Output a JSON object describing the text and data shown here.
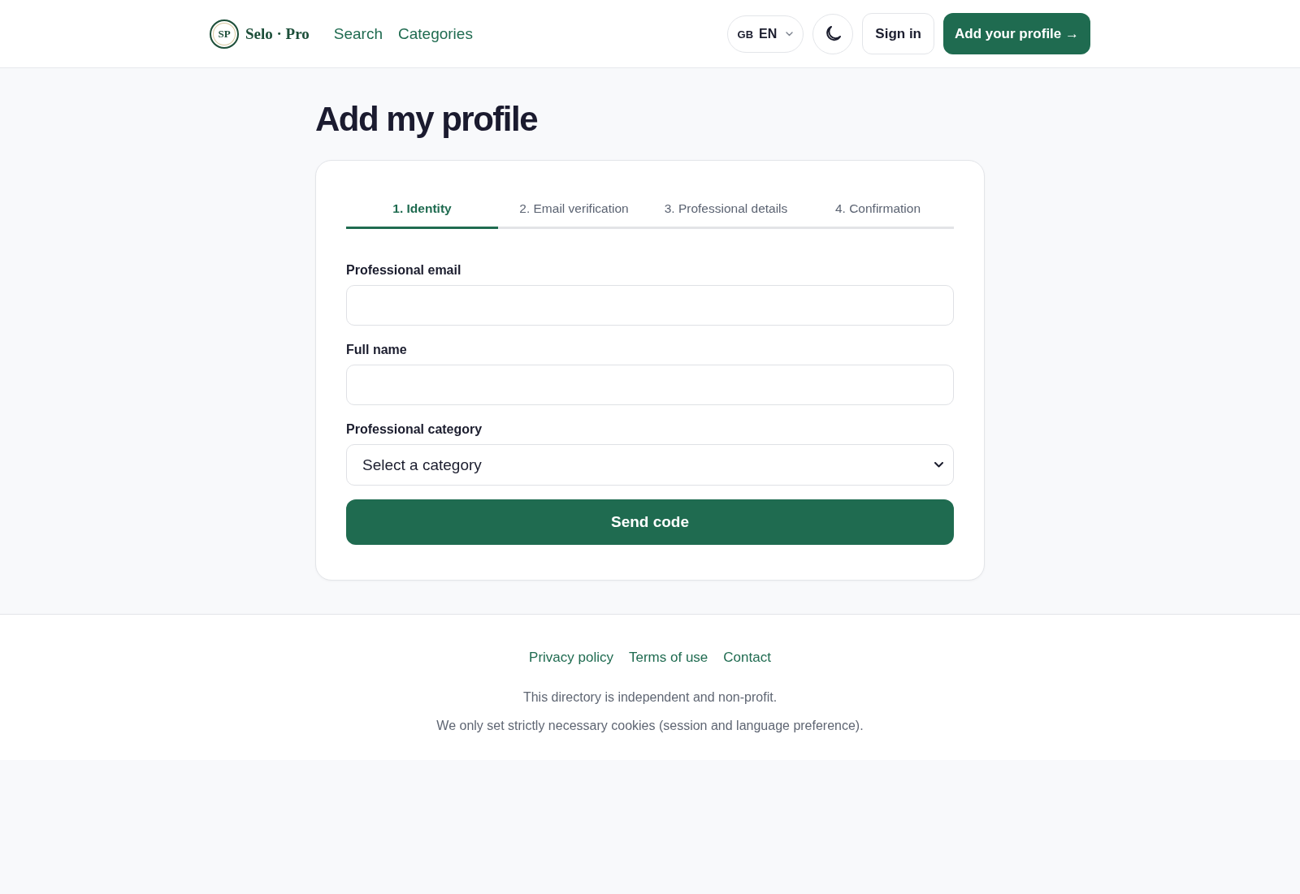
{
  "header": {
    "logo": {
      "monogram": "SP",
      "wordmark": "Selo · Pro"
    },
    "nav": [
      "Search",
      "Categories"
    ],
    "language": {
      "flag": "GB",
      "code": "EN"
    },
    "sign_in": "Sign in",
    "add_profile": "Add your profile →"
  },
  "page_title": "Add my profile",
  "steps": [
    {
      "label": "1. Identity",
      "selected": true
    },
    {
      "label": "2. Email verification",
      "selected": false
    },
    {
      "label": "3. Professional details",
      "selected": false
    },
    {
      "label": "4. Confirmation",
      "selected": false
    }
  ],
  "form": {
    "fields": [
      {
        "kind": "text",
        "label": "Professional email"
      },
      {
        "kind": "text",
        "label": "Full name"
      },
      {
        "kind": "select",
        "label": "Professional category",
        "value": "Select a category"
      }
    ],
    "submit": "Send code"
  },
  "footer": {
    "links": [
      "Privacy policy",
      "Terms of use",
      "Contact"
    ],
    "notes": [
      "This directory is independent and non-profit.",
      "We only set strictly necessary cookies (session and language preference)."
    ]
  }
}
